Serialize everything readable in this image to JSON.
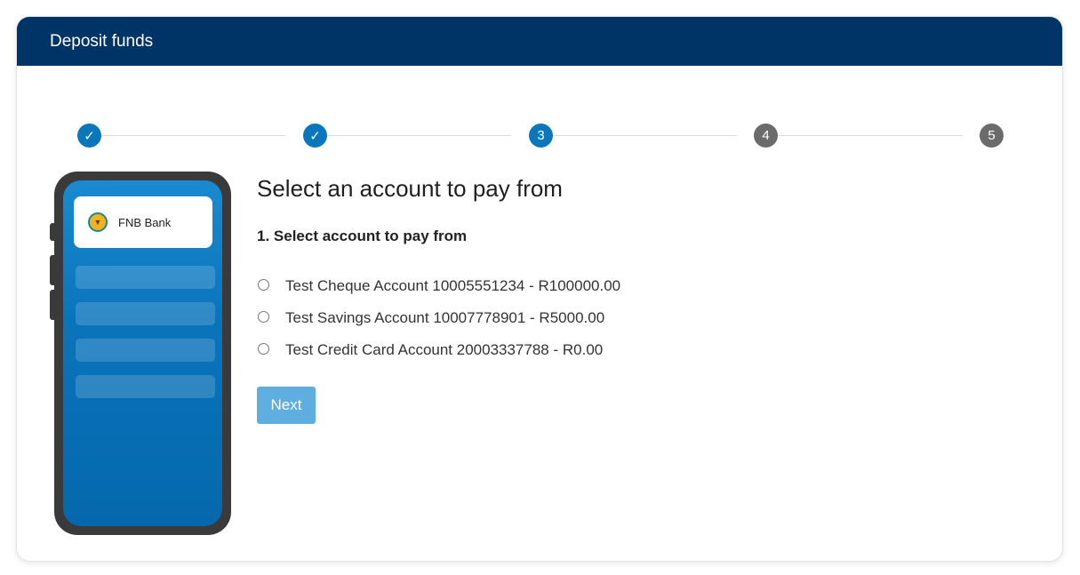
{
  "header": {
    "title": "Deposit funds"
  },
  "stepper": {
    "steps": [
      {
        "label": "✓",
        "state": "done"
      },
      {
        "label": "✓",
        "state": "done"
      },
      {
        "label": "3",
        "state": "current"
      },
      {
        "label": "4",
        "state": "pending"
      },
      {
        "label": "5",
        "state": "pending"
      }
    ]
  },
  "phone": {
    "bank_name": "FNB Bank"
  },
  "main": {
    "title": "Select an account to pay from",
    "subtitle": "1. Select account to pay from",
    "options": [
      "Test Cheque Account 10005551234 - R100000.00",
      "Test Savings Account 10007778901 - R5000.00",
      "Test Credit Card Account 20003337788 - R0.00"
    ],
    "next_label": "Next"
  },
  "colors": {
    "header_bg": "#003366",
    "accent": "#0a77bd",
    "pending_step": "#6b6b6b",
    "next_button": "#5faee0"
  }
}
